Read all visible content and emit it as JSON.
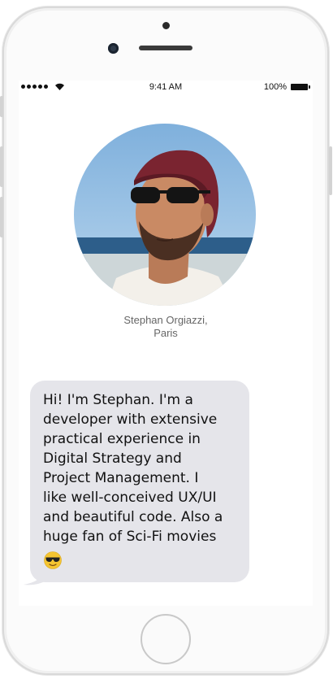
{
  "status_bar": {
    "time": "9:41 AM",
    "battery": "100%"
  },
  "profile": {
    "name": "Stephan Orgiazzi,",
    "city": "Paris"
  },
  "message": {
    "text": "Hi! I'm Stephan. I'm a\ndeveloper with extensive\npractical experience in\nDigital Strategy and\nProject Management. I\nlike well-conceived UX/UI\nand beautiful code. Also a\nhuge fan of Sci-Fi movies",
    "emoji": "sunglasses-face-icon"
  },
  "colors": {
    "bubble": "#e5e5ea",
    "name_text": "#666666"
  }
}
